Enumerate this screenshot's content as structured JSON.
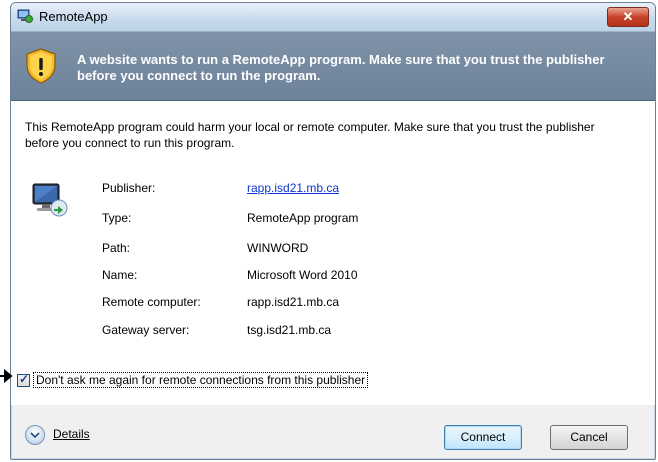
{
  "window": {
    "title": "RemoteApp",
    "close_label": "✕"
  },
  "banner": {
    "message": "A website wants to run a RemoteApp program. Make sure that you trust the publisher before you connect to run the program."
  },
  "warning_text": "This RemoteApp program could harm your local or remote computer. Make sure that you trust the publisher before you connect to run this program.",
  "properties": [
    {
      "label": "Publisher:",
      "value": "rapp.isd21.mb.ca",
      "is_link": true
    },
    {
      "label": "Type:",
      "value": "RemoteApp program"
    },
    {
      "label": "Path:",
      "value": "WINWORD"
    },
    {
      "label": "Name:",
      "value": "Microsoft Word 2010"
    },
    {
      "label": "Remote computer:",
      "value": "rapp.isd21.mb.ca"
    },
    {
      "label": "Gateway server:",
      "value": "tsg.isd21.mb.ca"
    }
  ],
  "options": {
    "dont_ask_label": "Don't ask me again for remote connections from this publisher",
    "dont_ask_checked": true
  },
  "footer": {
    "details_label": "Details",
    "connect_label": "Connect",
    "cancel_label": "Cancel"
  },
  "colors": {
    "banner": "#6c8299",
    "link": "#0b35d4",
    "close": "#c7432a"
  },
  "icons": [
    "remoteapp-icon",
    "shield-warning-icon",
    "computer-icon",
    "chevron-down-icon",
    "pointer-arrow-icon"
  ]
}
